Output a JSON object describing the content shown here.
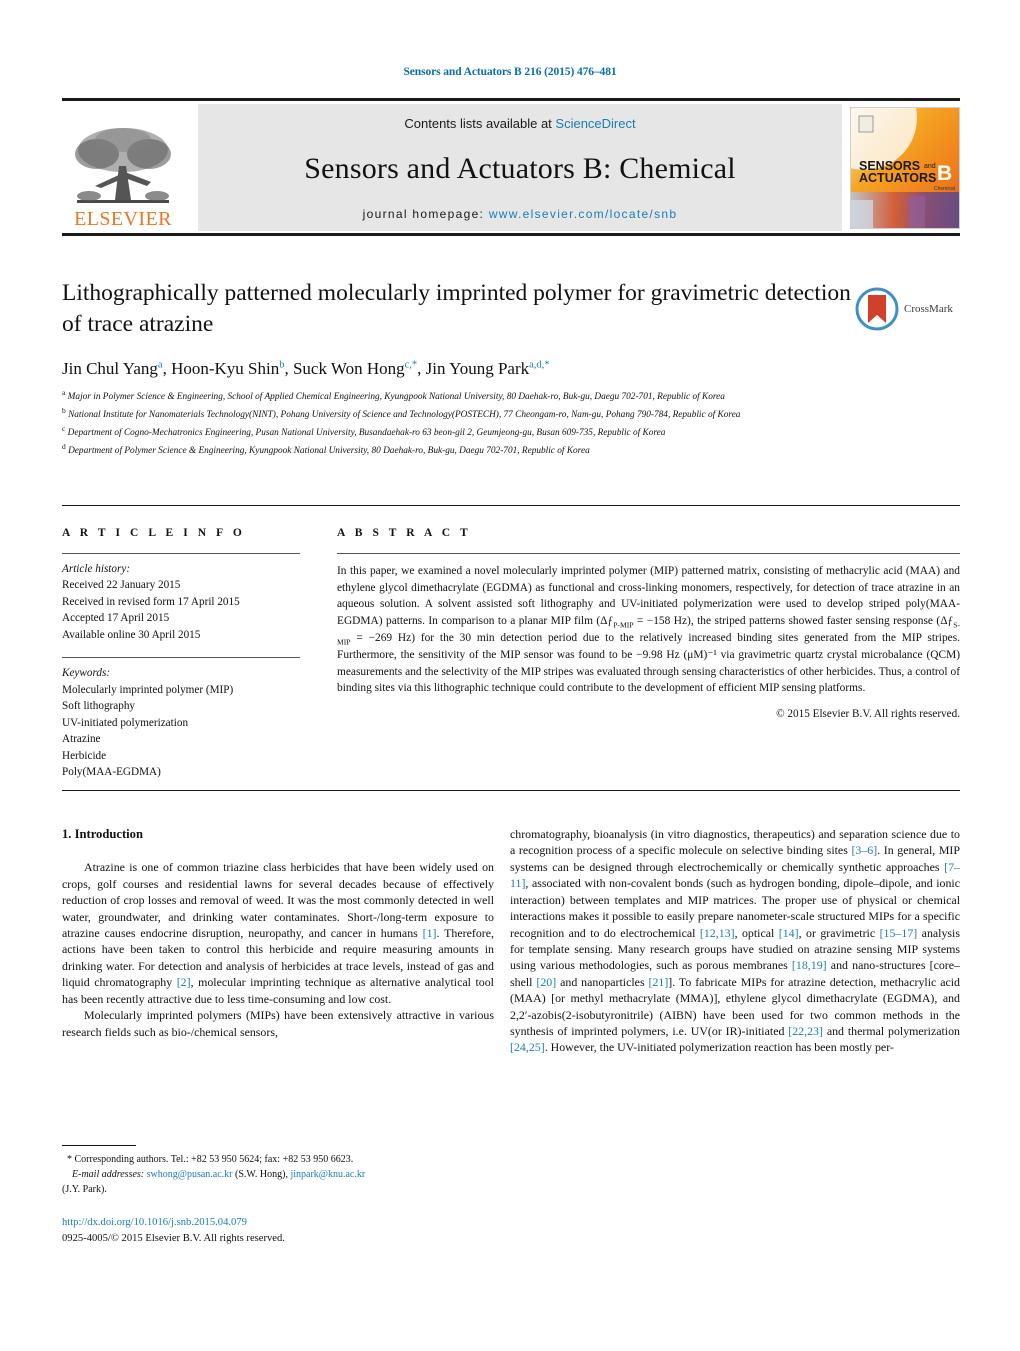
{
  "running_head": "Sensors and Actuators B 216 (2015) 476–481",
  "masthead": {
    "contents_prefix": "Contents lists available at ",
    "sciencedirect": "ScienceDirect",
    "journal_title": "Sensors and Actuators B: Chemical",
    "homepage_prefix": "journal homepage: ",
    "homepage_url": "www.elsevier.com/locate/snb",
    "publisher": "ELSEVIER",
    "cover": {
      "line1": "SENSORS",
      "line1b": "and",
      "line2": "ACTUATORS",
      "letter": "B",
      "sub": "Chemical"
    }
  },
  "article": {
    "title": "Lithographically patterned molecularly imprinted polymer for gravimetric detection of trace atrazine",
    "crossmark_label": "CrossMark",
    "authors": [
      {
        "name": "Jin Chul Yang",
        "marks": "a",
        "sep": ", "
      },
      {
        "name": "Hoon-Kyu Shin",
        "marks": "b",
        "sep": ", "
      },
      {
        "name": "Suck Won Hong",
        "marks": "c,*",
        "sep": ", "
      },
      {
        "name": "Jin Young Park",
        "marks": "a,d,*",
        "sep": ""
      }
    ],
    "affiliations": [
      {
        "mark": "a",
        "text": "Major in Polymer Science & Engineering, School of Applied Chemical Engineering, Kyungpook National University, 80 Daehak-ro, Buk-gu, Daegu 702-701, Republic of Korea"
      },
      {
        "mark": "b",
        "text": "National Institute for Nanomaterials Technology(NINT), Pohang University of Science and Technology(POSTECH), 77 Cheongam-ro, Nam-gu, Pohang 790-784, Republic of Korea"
      },
      {
        "mark": "c",
        "text": "Department of Cogno-Mechatronics Engineering, Pusan National University, Busandaehak-ro 63 beon-gil 2, Geumjeong-gu, Busan 609-735, Republic of Korea"
      },
      {
        "mark": "d",
        "text": "Department of Polymer Science & Engineering, Kyungpook National University, 80 Daehak-ro, Buk-gu, Daegu 702-701, Republic of Korea"
      }
    ]
  },
  "article_info": {
    "heading": "A R T I C L E   I N F O",
    "history_label": "Article history:",
    "history": [
      "Received 22 January 2015",
      "Received in revised form 17 April 2015",
      "Accepted 17 April 2015",
      "Available online 30 April 2015"
    ],
    "keywords_label": "Keywords:",
    "keywords": [
      "Molecularly imprinted polymer (MIP)",
      "Soft lithography",
      "UV-initiated polymerization",
      "Atrazine",
      "Herbicide",
      "Poly(MAA-EGDMA)"
    ]
  },
  "abstract": {
    "heading": "A B S T R A C T",
    "part1": "In this paper, we examined a novel molecularly imprinted polymer (MIP) patterned matrix, consisting of methacrylic acid (MAA) and ethylene glycol dimethacrylate (EGDMA) as functional and cross-linking monomers, respectively, for detection of trace atrazine in an aqueous solution. A solvent assisted soft lithography and UV-initiated polymerization were used to develop striped poly(MAA-EGDMA) patterns. In comparison to a planar MIP film (Δƒ",
    "sub1": "P-MIP",
    "part2": " = −158 Hz), the striped patterns showed faster sensing response (Δƒ",
    "sub2": "S-MIP",
    "part3": " = −269 Hz) for the 30 min detection period due to the relatively increased binding sites generated from the MIP stripes. Furthermore, the sensitivity of the MIP sensor was found to be −9.98 Hz (μM)⁻¹ via gravimetric quartz crystal microbalance (QCM) measurements and the selectivity of the MIP stripes was evaluated through sensing characteristics of other herbicides. Thus, a control of binding sites via this lithographic technique could contribute to the development of efficient MIP sensing platforms.",
    "copyright": "© 2015 Elsevier B.V. All rights reserved."
  },
  "body": {
    "intro_heading": "1.  Introduction",
    "left": {
      "p1_a": "Atrazine is one of common triazine class herbicides that have been widely used on crops, golf courses and residential lawns for several decades because of effectively reduction of crop losses and removal of weed. It was the most commonly detected in well water, groundwater, and drinking water contaminates. Short-/long-term exposure to atrazine causes endocrine disruption, neuropathy, and cancer in humans ",
      "p1_r1": "[1]",
      "p1_b": ". Therefore, actions have been taken to control this herbicide and require measuring amounts in drinking water. For detection and analysis of herbicides at trace levels, instead of gas and liquid chromatography ",
      "p1_r2": "[2]",
      "p1_c": ", molecular imprinting technique as alternative analytical tool has been recently attractive due to less time-consuming and low cost.",
      "p2": "Molecularly imprinted polymers (MIPs) have been extensively attractive in various research fields such as bio-/chemical sensors,"
    },
    "right": {
      "a": "chromatography, bioanalysis (in vitro diagnostics, therapeutics) and separation science due to a recognition process of a specific molecule on selective binding sites ",
      "r1": "[3–6]",
      "b": ". In general, MIP systems can be designed through electrochemically or chemically synthetic approaches ",
      "r2": "[7–11]",
      "c": ", associated with non-covalent bonds (such as hydrogen bonding, dipole–dipole, and ionic interaction) between templates and MIP matrices. The proper use of physical or chemical interactions makes it possible to easily prepare nanometer-scale structured MIPs for a specific recognition and to do electrochemical ",
      "r3": "[12,13]",
      "d": ", optical ",
      "r4": "[14]",
      "e": ", or gravimetric ",
      "r5": "[15–17]",
      "f": " analysis for template sensing. Many research groups have studied on atrazine sensing MIP systems using various methodologies, such as porous membranes ",
      "r6": "[18,19]",
      "g": " and nano-structures [core–shell ",
      "r7": "[20]",
      "h": " and nanoparticles ",
      "r8": "[21]",
      "i": "]. To fabricate MIPs for atrazine detection, methacrylic acid (MAA) [or methyl methacrylate (MMA)], ethylene glycol dimethacrylate (EGDMA), and 2,2′-azobis(2-isobutyronitrile) (AIBN) have been used for two common methods in the synthesis of imprinted polymers, i.e. UV(or IR)-initiated ",
      "r9": "[22,23]",
      "j": " and thermal polymerization ",
      "r10": "[24,25]",
      "k": ". However, the UV-initiated polymerization reaction has been mostly per-"
    }
  },
  "footer": {
    "corresponding_star": "*",
    "corresponding_text": "Corresponding authors. Tel.: +82 53 950 5624; fax: +82 53 950 6623.",
    "email_label": "E-mail addresses:",
    "email1": "swhong@pusan.ac.kr",
    "email1_owner": " (S.W. Hong), ",
    "email2": "jinpark@knu.ac.kr",
    "email2_owner": "(J.Y. Park).",
    "doi": "http://dx.doi.org/10.1016/j.snb.2015.04.079",
    "issn_line": "0925-4005/© 2015 Elsevier B.V. All rights reserved."
  },
  "colors": {
    "link": "#1a7db5",
    "elsevier_orange": "#E87722",
    "band_gray": "#e6e6e6"
  }
}
